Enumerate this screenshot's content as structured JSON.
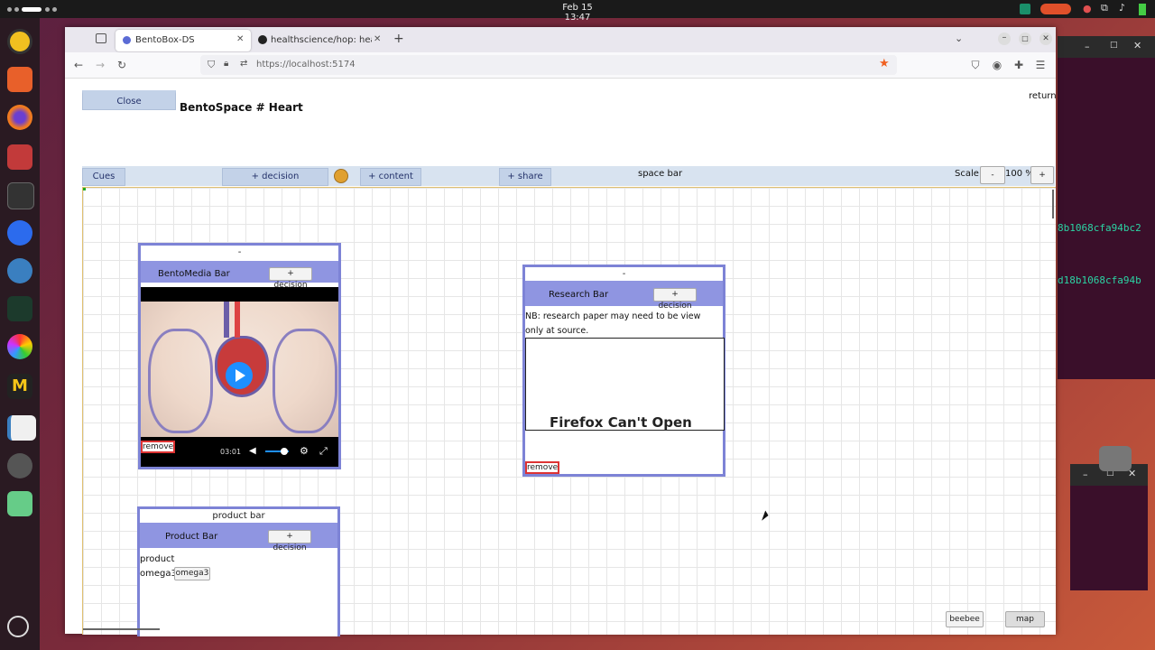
{
  "system": {
    "clock": "Feb 15  13:47"
  },
  "terminal": {
    "line1": "8b1068cfa94bc2",
    "line2": "d18b1068cfa94b"
  },
  "browser": {
    "tabs": [
      {
        "label": "BentoBox-DS"
      },
      {
        "label": "healthscience/hop: healt"
      }
    ],
    "url": "https://localhost:5174"
  },
  "page": {
    "close_label": "Close",
    "title": "BentoSpace # Heart",
    "return_label": "return",
    "spacebar": {
      "cues_label": "Cues",
      "decision_label": "+ decision",
      "content_label": "+ content",
      "share_label": "+ share",
      "title": "space bar",
      "scale_label": "Scale",
      "scale_minus": "-",
      "scale_value": "100 %",
      "scale_plus": "+"
    },
    "media_card": {
      "top": "-",
      "bar_title": "BentoMedia Bar",
      "decision_label": "+ decision",
      "video_time": "03:01",
      "remove_label": "remove"
    },
    "research_card": {
      "top": "-",
      "bar_title": "Research Bar",
      "decision_label": "+ decision",
      "note": "NB: research paper may need to be view only at source.",
      "frame_error": "Firefox Can't Open",
      "remove_label": "remove"
    },
    "product_card": {
      "top": "product bar",
      "bar_title": "Product Bar",
      "decision_label": "+ decision",
      "product_label": "product",
      "item_label": "omega3",
      "item_button": "omega3"
    },
    "footer": {
      "beebee_label": "beebee",
      "map_label": "map"
    }
  }
}
